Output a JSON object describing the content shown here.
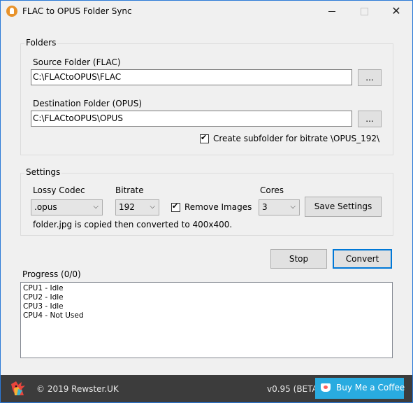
{
  "window": {
    "title": "FLAC to OPUS Folder Sync",
    "minimize_symbol": "",
    "maximize_symbol": "",
    "close_symbol": "✕"
  },
  "folders": {
    "group_label": "Folders",
    "source_label": "Source Folder (FLAC)",
    "source_value": "C:\\FLACtoOPUS\\FLAC",
    "source_browse": "...",
    "dest_label": "Destination Folder (OPUS)",
    "dest_value": "C:\\FLACtoOPUS\\OPUS",
    "dest_browse": "...",
    "subfolder_label": "Create subfolder for bitrate \\OPUS_192\\",
    "subfolder_checked": true
  },
  "settings": {
    "group_label": "Settings",
    "codec_label": "Lossy Codec",
    "codec_value": ".opus",
    "bitrate_label": "Bitrate",
    "bitrate_value": "192",
    "remove_images_label": "Remove Images",
    "remove_images_checked": true,
    "cores_label": "Cores",
    "cores_value": "3",
    "save_button": "Save Settings",
    "info_text": "folder.jpg is copied then converted to 400x400."
  },
  "actions": {
    "stop": "Stop",
    "convert": "Convert"
  },
  "progress": {
    "label": "Progress (0/0)",
    "lines": [
      "CPU1 - Idle",
      "CPU2 - Idle",
      "CPU3 - Idle",
      "CPU4 - Not Used"
    ]
  },
  "footer": {
    "copyright": "© 2019 Rewster.UK",
    "version": "v0.95 (BETA)",
    "coffee_button": "Buy Me a Coffee"
  },
  "colors": {
    "accent": "#0078d7",
    "coffee": "#29abe0",
    "footer_bg": "#3c3c3c"
  }
}
